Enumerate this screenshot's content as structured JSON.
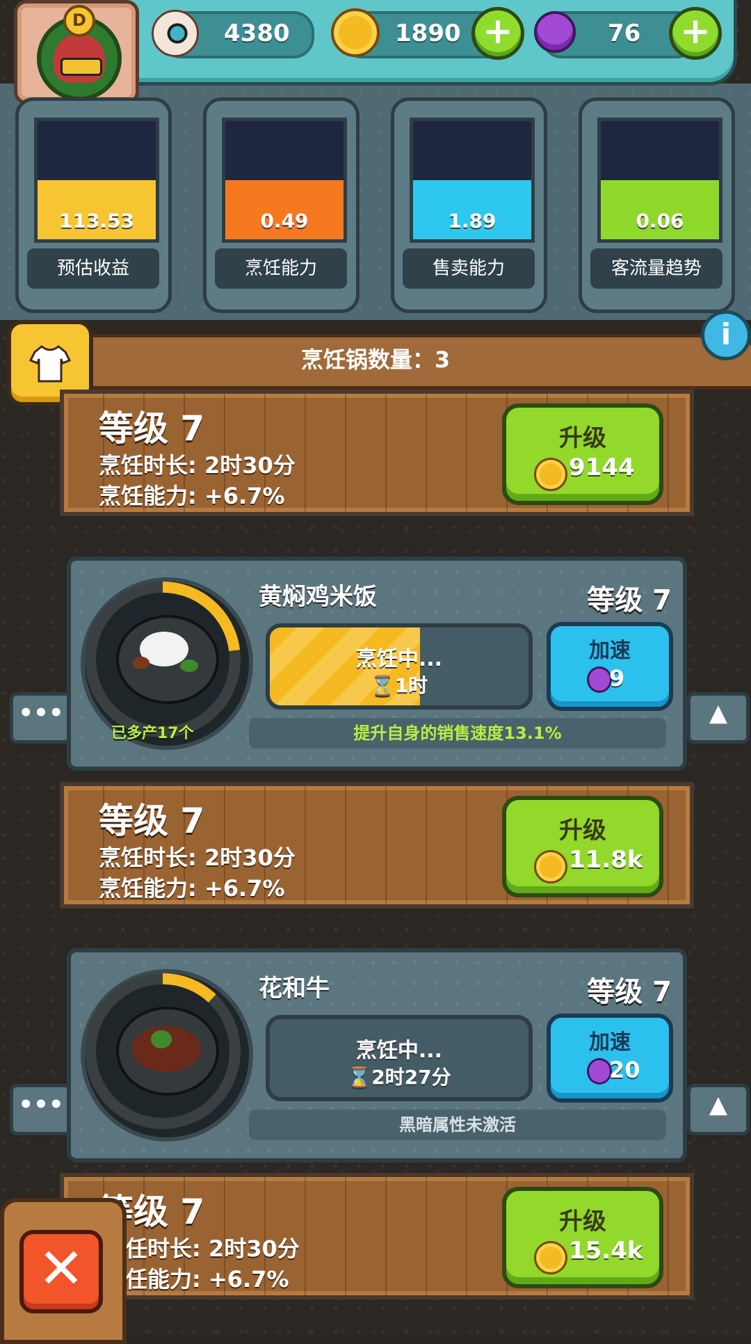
{
  "resources": {
    "eyeball": {
      "value": "4380",
      "icon": "eyeball-icon"
    },
    "coins": {
      "value": "1890",
      "icon": "coin-icon"
    },
    "potions": {
      "value": "76",
      "icon": "potion-icon"
    },
    "add_symbol": "+"
  },
  "avatar": {
    "rank": "D"
  },
  "stats": [
    {
      "value": "113.53",
      "label": "预估收益",
      "color": "#f7c531",
      "fill": 0.5
    },
    {
      "value": "0.49",
      "label": "烹饪能力",
      "color": "#f7791f",
      "fill": 0.5
    },
    {
      "value": "1.89",
      "label": "售卖能力",
      "color": "#2ec8ee",
      "fill": 0.5
    },
    {
      "value": "0.06",
      "label": "客流量趋势",
      "color": "#8fd82c",
      "fill": 0.5
    }
  ],
  "pot_count_label": "烹饪锅数量：3",
  "info_symbol": "i",
  "upgrades": [
    {
      "level": "等级 7",
      "duration": "烹饪时长: 2时30分",
      "ability": "烹饪能力: +6.7%",
      "button": "升级",
      "cost": "9144"
    },
    {
      "level": "等级 7",
      "duration": "烹饪时长: 2时30分",
      "ability": "烹饪能力: +6.7%",
      "button": "升级",
      "cost": "11.8k"
    },
    {
      "level": "等级 7",
      "duration": "任时长: 2时30分",
      "ability": "任能力: +6.7%",
      "button": "升级",
      "cost": "15.4k"
    }
  ],
  "dishes": [
    {
      "name": "黄焖鸡米饭",
      "level": "等级 7",
      "status": "烹饪中...",
      "time": "1时",
      "progress": 0.58,
      "speed_label": "加速",
      "speed_cost": "9",
      "produced": "已多产17个",
      "note": "提升自身的销售速度13.1%",
      "note_color": "#b8ee40",
      "ring": 0.23
    },
    {
      "name": "花和牛",
      "level": "等级 7",
      "status": "烹饪中...",
      "time": "2时27分",
      "progress": 0,
      "speed_label": "加速",
      "speed_cost": "20",
      "produced": "",
      "note": "黑暗属性未激活",
      "note_color": "#d8e2e6",
      "ring": 0.12
    }
  ],
  "more_symbol": "•••",
  "collapse_symbol": "▲",
  "close_symbol": "✕"
}
